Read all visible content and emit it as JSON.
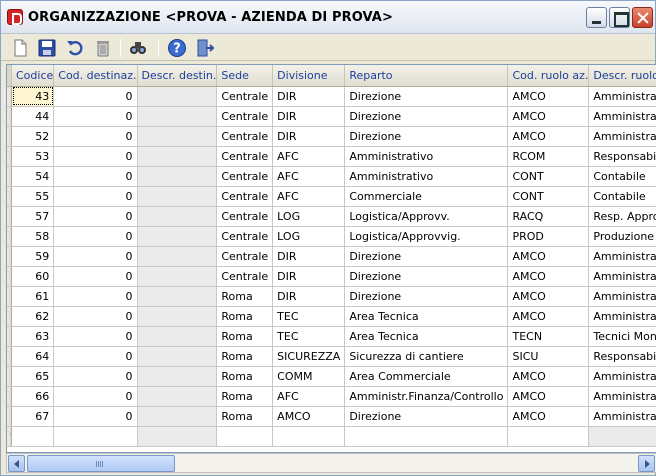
{
  "window": {
    "title": "ORGANIZZAZIONE <PROVA - AZIENDA DI PROVA>"
  },
  "toolbar": {
    "buttons": [
      {
        "name": "new-icon"
      },
      {
        "name": "save-icon"
      },
      {
        "name": "undo-icon"
      },
      {
        "name": "delete-icon"
      },
      {
        "name": "search-icon"
      },
      {
        "name": "help-icon"
      },
      {
        "name": "exit-icon"
      }
    ]
  },
  "grid": {
    "columns": [
      "Codice",
      "Cod. destinaz.",
      "Descr. destin.",
      "Sede",
      "Divisione",
      "Reparto",
      "Cod. ruolo az.",
      "Descr. ruolo"
    ],
    "rows": [
      [
        "43",
        "0",
        "",
        "Centrale",
        "DIR",
        "Direzione",
        "AMCO",
        "Amministratore di c"
      ],
      [
        "44",
        "0",
        "",
        "Centrale",
        "DIR",
        "Direzione",
        "AMCO",
        "Amministratore di c"
      ],
      [
        "52",
        "0",
        "",
        "Centrale",
        "DIR",
        "Direzione",
        "AMCO",
        "Amministratore di c"
      ],
      [
        "53",
        "0",
        "",
        "Centrale",
        "AFC",
        "Amministrativo",
        "RCOM",
        "Responsabile Com"
      ],
      [
        "54",
        "0",
        "",
        "Centrale",
        "AFC",
        "Amministrativo",
        "CONT",
        "Contabile"
      ],
      [
        "55",
        "0",
        "",
        "Centrale",
        "AFC",
        "Commerciale",
        "CONT",
        "Contabile"
      ],
      [
        "57",
        "0",
        "",
        "Centrale",
        "LOG",
        "Logistica/Approvv.",
        "RACQ",
        "Resp. Approvvigio"
      ],
      [
        "58",
        "0",
        "",
        "Centrale",
        "LOG",
        "Logistica/Approvvig.",
        "PROD",
        "Produzione"
      ],
      [
        "59",
        "0",
        "",
        "Centrale",
        "DIR",
        "Direzione",
        "AMCO",
        "Amministratore di c"
      ],
      [
        "60",
        "0",
        "",
        "Centrale",
        "DIR",
        "Direzione",
        "AMCO",
        "Amministratore di c"
      ],
      [
        "61",
        "0",
        "",
        "Roma",
        "DIR",
        "Direzione",
        "AMCO",
        "Amministratore di c"
      ],
      [
        "62",
        "0",
        "",
        "Roma",
        "TEC",
        "Area Tecnica",
        "AMCO",
        "Amministratore di c"
      ],
      [
        "63",
        "0",
        "",
        "Roma",
        "TEC",
        "Area Tecnica",
        "TECN",
        "Tecnici Montatori /"
      ],
      [
        "64",
        "0",
        "",
        "Roma",
        "SICUREZZA",
        "Sicurezza di cantiere",
        "SICU",
        "Responsabile Sicur"
      ],
      [
        "65",
        "0",
        "",
        "Roma",
        "COMM",
        "Area Commerciale",
        "AMCO",
        "Amministratore di c"
      ],
      [
        "66",
        "0",
        "",
        "Roma",
        "AFC",
        "Amministr.Finanza/Controllo",
        "AMCO",
        "Amministratore di c"
      ],
      [
        "67",
        "0",
        "",
        "Roma",
        "AMCO",
        "Direzione",
        "AMCO",
        "Amministratore di c"
      ]
    ],
    "new_row_marker": "*"
  }
}
